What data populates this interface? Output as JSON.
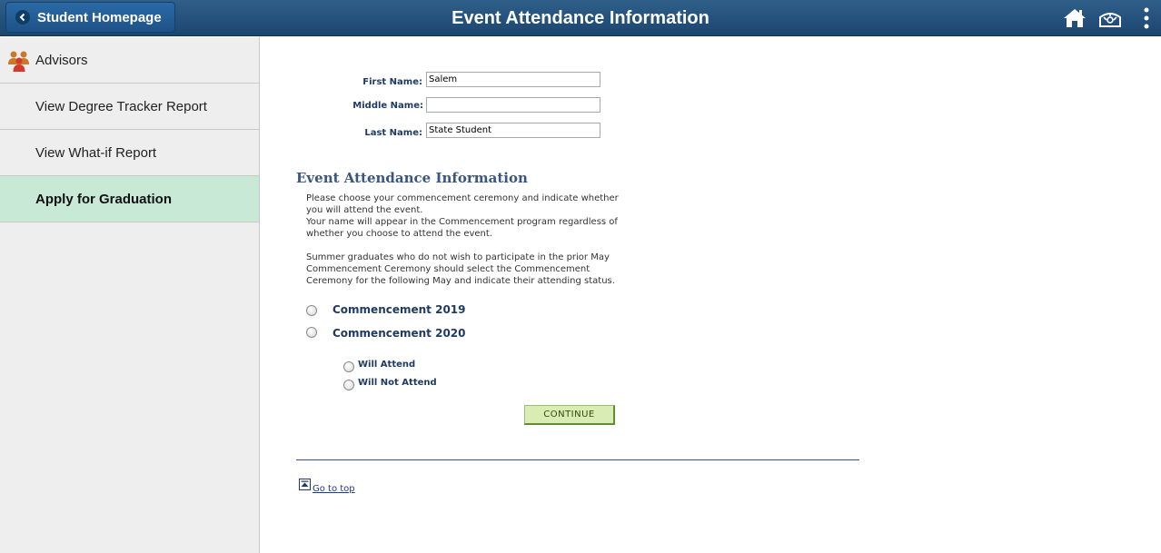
{
  "header": {
    "back_label": "Student Homepage",
    "title": "Event Attendance Information"
  },
  "sidebar": {
    "items": [
      {
        "label": "Advisors",
        "icon": "advisors-icon"
      },
      {
        "label": "View Degree Tracker Report"
      },
      {
        "label": "View What-if Report"
      },
      {
        "label": "Apply for Graduation",
        "active": true
      }
    ]
  },
  "form": {
    "first_name_label": "First Name:",
    "first_name_value": "Salem",
    "middle_name_label": "Middle Name:",
    "middle_name_value": "",
    "last_name_label": "Last Name:",
    "last_name_value": "State Student"
  },
  "event": {
    "section_title": "Event Attendance Information",
    "instructions_1": "Please choose your commencement ceremony and indicate whether you will attend the event.",
    "instructions_2": "Your name will appear in the Commencement program regardless of whether you choose to attend the event.",
    "instructions_3": "Summer graduates who do not wish to participate in the prior May Commencement Ceremony should select the Commencement Ceremony for the following May and indicate their attending status.",
    "ceremony_options": [
      "Commencement 2019",
      "Commencement 2020"
    ],
    "attendance_options": [
      "Will Attend",
      "Will Not Attend"
    ],
    "continue_label": "CONTINUE",
    "go_to_top_label": "Go to top"
  },
  "colors": {
    "header_bg": "#1b4670",
    "active_item_bg": "#c8e9d6",
    "label_color": "#1f3a66",
    "continue_bg": "#d9ecb4"
  }
}
